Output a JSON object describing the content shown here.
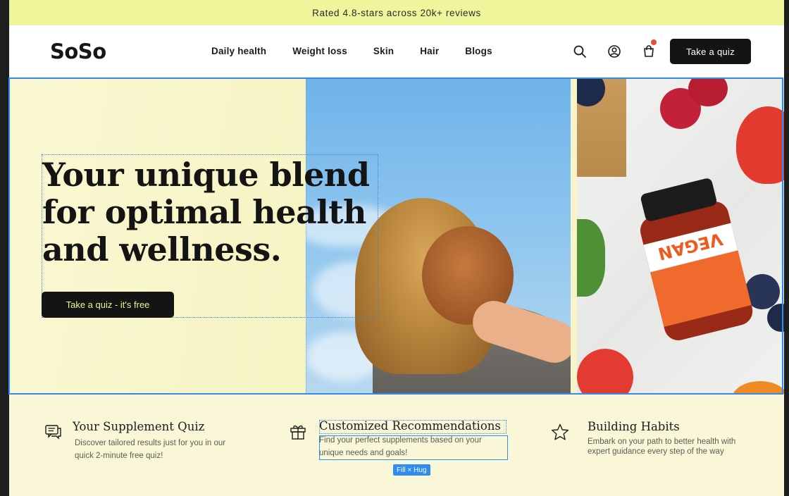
{
  "promo": {
    "text": "Rated 4.8-stars across 20k+ reviews"
  },
  "header": {
    "logo": "SoSo",
    "nav": [
      "Daily health",
      "Weight loss",
      "Skin",
      "Hair",
      "Blogs"
    ],
    "cta": "Take a quiz",
    "icons": [
      "search-icon",
      "account-icon",
      "cart-icon"
    ]
  },
  "hero": {
    "headline_lines": [
      "Your unique blend",
      "for optimal health",
      "and wellness."
    ],
    "cta": "Take a quiz - it's free",
    "bottle_label": "VEGAN"
  },
  "features": [
    {
      "icon": "chat-icon",
      "title": "Your Supplement Quiz",
      "desc": "Discover tailored results just for you in our quick 2-minute free quiz!"
    },
    {
      "icon": "gift-icon",
      "title": "Customized Recommendations",
      "desc": "Find your perfect supplements based on your unique needs and goals!"
    },
    {
      "icon": "star-icon",
      "title": "Building Habits",
      "desc": "Embark on your path to better health with expert guidance every step of the way"
    }
  ],
  "editor": {
    "sizing_badge": "Fill × Hug"
  },
  "colors": {
    "promo_bg": "#eef59a",
    "selection": "#2f8cf0",
    "button_dark": "#141414",
    "hero_button_text": "#f2f28e",
    "cart_dot": "#e64a3b"
  }
}
